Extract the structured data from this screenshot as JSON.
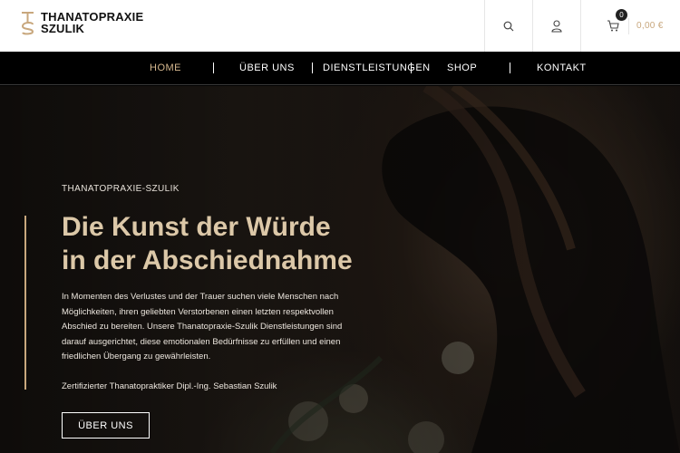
{
  "brand": {
    "line1": "THANATOPRAXIE",
    "line2": "SZULIK"
  },
  "header": {
    "cart_count": "0",
    "cart_total": "0,00 €"
  },
  "nav": {
    "items": [
      {
        "label": "HOME",
        "active": true
      },
      {
        "label": "ÜBER UNS"
      },
      {
        "label": "DIENSTLEISTUNGEN"
      },
      {
        "label": "SHOP"
      },
      {
        "label": "KONTAKT"
      }
    ]
  },
  "hero": {
    "eyebrow": "THANATOPRAXIE-SZULIK",
    "headline_line1": "Die Kunst der Würde",
    "headline_line2": "in der Abschiednahme",
    "body": "In Momenten des Verlustes und der Trauer suchen viele Menschen nach Möglichkeiten, ihren geliebten Verstorbenen einen letzten respektvollen Abschied zu bereiten. Unsere Thanatopraxie-Szulik Dienstleistungen sind darauf ausgerichtet, diese emotionalen Bedürfnisse zu erfüllen und einen friedlichen Übergang zu gewährleisten.",
    "credit": "Zertifizierter Thanatopraktiker Dipl.-Ing. Sebastian Szulik",
    "cta_label": "ÜBER UNS"
  },
  "colors": {
    "accent": "#c8a77d",
    "headline": "#dcc8a8",
    "nav_active": "#d6b88f"
  },
  "icons": {
    "logo": "ts-monogram-icon",
    "search": "search-icon",
    "account": "user-icon",
    "cart": "cart-icon"
  }
}
